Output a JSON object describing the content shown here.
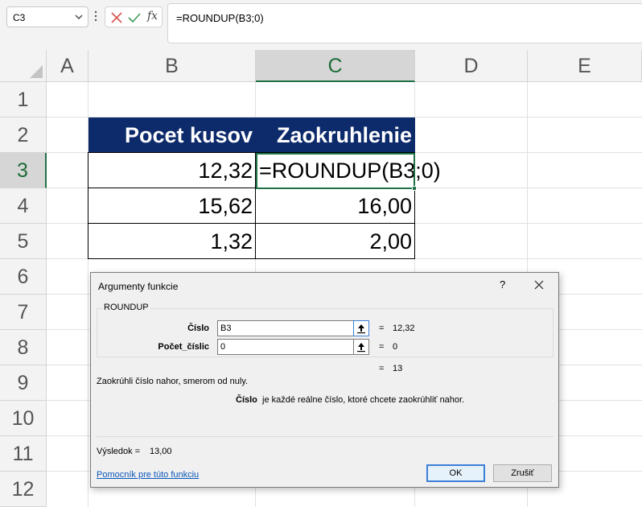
{
  "formula_bar": {
    "name_box": "C3",
    "formula": "=ROUNDUP(B3;0)",
    "fx_label": "fx"
  },
  "columns": [
    "A",
    "B",
    "C",
    "D",
    "E"
  ],
  "rows": [
    "1",
    "2",
    "3",
    "4",
    "5",
    "6",
    "7",
    "8",
    "9",
    "10",
    "11",
    "12"
  ],
  "table": {
    "header": [
      "Pocet kusov",
      "Zaokruhlenie"
    ],
    "rows": [
      [
        "12,32",
        "=ROUNDUP(B3;0)"
      ],
      [
        "15,62",
        "16,00"
      ],
      [
        "1,32",
        "2,00"
      ]
    ]
  },
  "dialog": {
    "title": "Argumenty funkcie",
    "help": "?",
    "function_name": "ROUNDUP",
    "args": [
      {
        "label": "Číslo",
        "value": "B3",
        "result": "12,32"
      },
      {
        "label": "Počet_číslic",
        "value": "0",
        "result": "0"
      }
    ],
    "equals": "=",
    "formula_result": "13",
    "description": "Zaokrúhli číslo nahor, smerom od nuly.",
    "arg_help_name": "Číslo",
    "arg_help_text": "je každé reálne číslo, ktoré chcete zaokrúhliť nahor.",
    "result_label": "Výsledok =",
    "result_value": "13,00",
    "help_link": "Pomocník pre túto funkciu",
    "ok_label": "OK",
    "cancel_label": "Zrušiť"
  },
  "colors": {
    "header_fill": "#0d2a6b",
    "selection_green": "#1e7145",
    "link_blue": "#0a56b8"
  },
  "icons": [
    "chevron-down-icon",
    "more-vertical-icon",
    "cancel-x-icon",
    "check-icon",
    "fx-icon",
    "collapse-dialog-icon",
    "close-icon"
  ]
}
